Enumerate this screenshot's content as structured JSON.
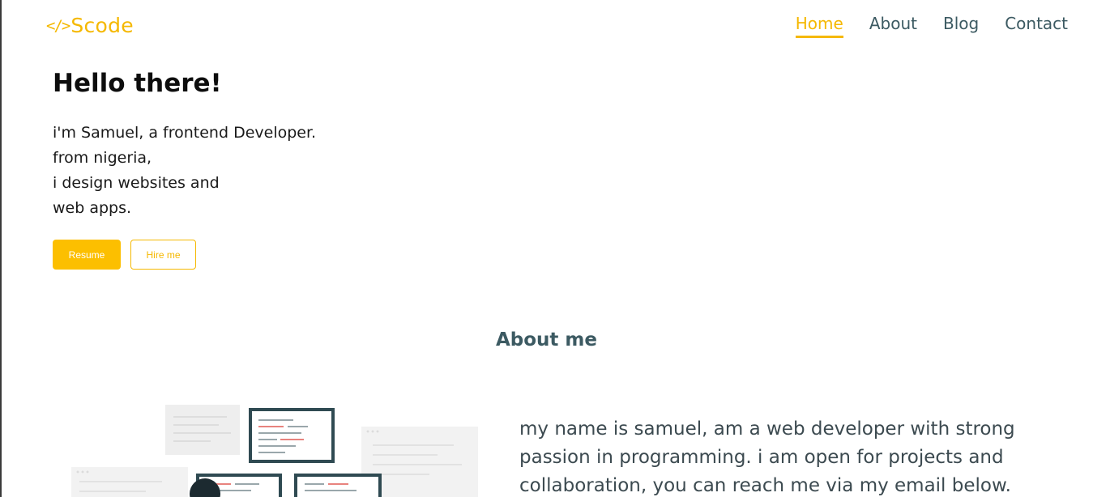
{
  "header": {
    "logo_icon": "</>",
    "logo_text": "Scode",
    "nav": [
      {
        "label": "Home",
        "active": true
      },
      {
        "label": "About",
        "active": false
      },
      {
        "label": "Blog",
        "active": false
      },
      {
        "label": "Contact",
        "active": false
      }
    ]
  },
  "hero": {
    "title": "Hello there!",
    "lines": [
      "i'm Samuel, a frontend Developer.",
      "from nigeria,",
      "i design websites and",
      "web apps."
    ],
    "resume_label": "Resume",
    "hire_label": "Hire me"
  },
  "about": {
    "heading": "About me",
    "lines": [
      "my name is samuel, am a web developer with strong",
      "passion in programming. i am open for projects and",
      "collaboration, you can reach me via my email below."
    ]
  },
  "colors": {
    "accent": "#fcbf00",
    "heading": "#3c5a62"
  }
}
